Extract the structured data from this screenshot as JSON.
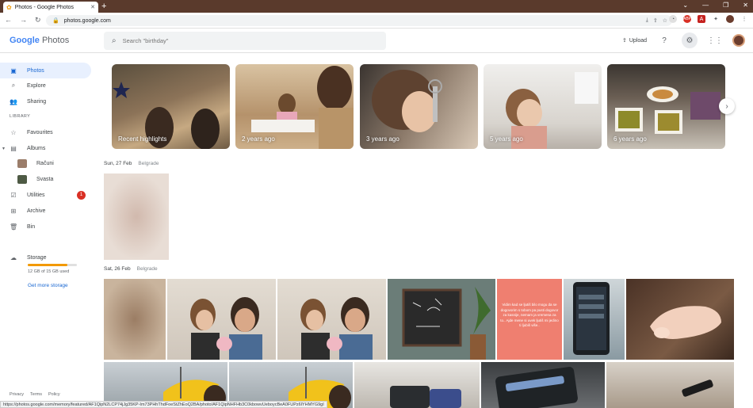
{
  "browser": {
    "tab_title": "Photos - Google Photos",
    "new_tab": "+",
    "window_controls": [
      "⌄",
      "—",
      "❐",
      "✕"
    ],
    "url": "photos.google.com",
    "nav_icons": [
      "back-icon",
      "forward-icon",
      "reload-icon"
    ]
  },
  "header": {
    "logo_google": "Google",
    "logo_photos": "Photos",
    "search_placeholder": "Search \"birthday\"",
    "upload_label": "Upload"
  },
  "sidebar": {
    "items": [
      {
        "label": "Photos",
        "icon": "photo-icon"
      },
      {
        "label": "Explore",
        "icon": "search-icon"
      },
      {
        "label": "Sharing",
        "icon": "people-icon"
      }
    ],
    "library_label": "LIBRARY",
    "library_items": [
      {
        "label": "Favourites",
        "icon": "star-icon"
      },
      {
        "label": "Albums",
        "icon": "album-icon"
      },
      {
        "label": "Računi",
        "icon": "album-thumb"
      },
      {
        "label": "Svasta",
        "icon": "album-thumb"
      },
      {
        "label": "Utilities",
        "icon": "utilities-icon",
        "badge": "1"
      },
      {
        "label": "Archive",
        "icon": "archive-icon"
      },
      {
        "label": "Bin",
        "icon": "trash-icon"
      }
    ],
    "storage": {
      "label": "Storage",
      "used_text": "12 GB of 15 GB used",
      "used_fraction": 0.8,
      "cta": "Get more storage"
    },
    "footer": [
      "Privacy",
      "Terms",
      "Policy"
    ]
  },
  "memories": [
    {
      "label": "Recent highlights"
    },
    {
      "label": "2 years ago"
    },
    {
      "label": "3 years ago"
    },
    {
      "label": "5 years ago"
    },
    {
      "label": "6 years ago"
    }
  ],
  "sections": [
    {
      "date": "Sun, 27 Feb",
      "location": "Belgrade"
    },
    {
      "date": "Sat, 26 Feb",
      "location": "Belgrade"
    }
  ],
  "note_photo_text": "Vidim kad se ljutiš bilo mogu da se dogovorim s tobom pa pusti dogovor za kasnije, nemam ja vremena za to.. Ajde mene si uvek ljutiš mi jedino ti ljubiš više..",
  "status_url": "https://photos.google.com/memory/featured/AF1QipN2LCP74jJg35KP-Im73PHhThdFoeStZhEoQ2BA/photo/AF1QipNHFHb3C0kbowvUeboycBeA0FUPz6lYHMYG9gI",
  "colors": {
    "accent": "#1967d2",
    "tabbar": "#5a3a2c",
    "badge": "#d93025",
    "storage_fill": "#f29900"
  }
}
